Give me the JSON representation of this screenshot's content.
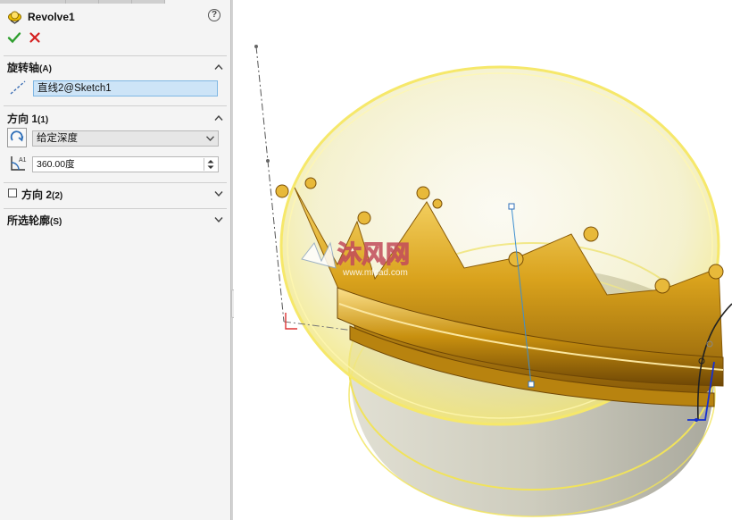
{
  "feature": {
    "title": "Revolve1",
    "help_symbol": "?"
  },
  "sections": {
    "axis": {
      "title": "旋转轴",
      "shortcut": "(A)",
      "value": "直线2@Sketch1"
    },
    "direction1": {
      "title": "方向 1",
      "shortcut": "(1)",
      "end_condition": "给定深度",
      "angle": "360.00度"
    },
    "direction2": {
      "title": "方向 2",
      "shortcut": "(2)",
      "checked": false
    },
    "profiles": {
      "title": "所选轮廓",
      "shortcut": "(S)"
    }
  },
  "watermark": {
    "brand": "沐风网",
    "url": "www.mfcad.com"
  },
  "colors": {
    "accent_green": "#2e9e2e",
    "cancel_red": "#d42020",
    "field_highlight": "#cde4f7",
    "ring_yellow": "#f5e76a",
    "crown_gold": "#d4a017"
  }
}
